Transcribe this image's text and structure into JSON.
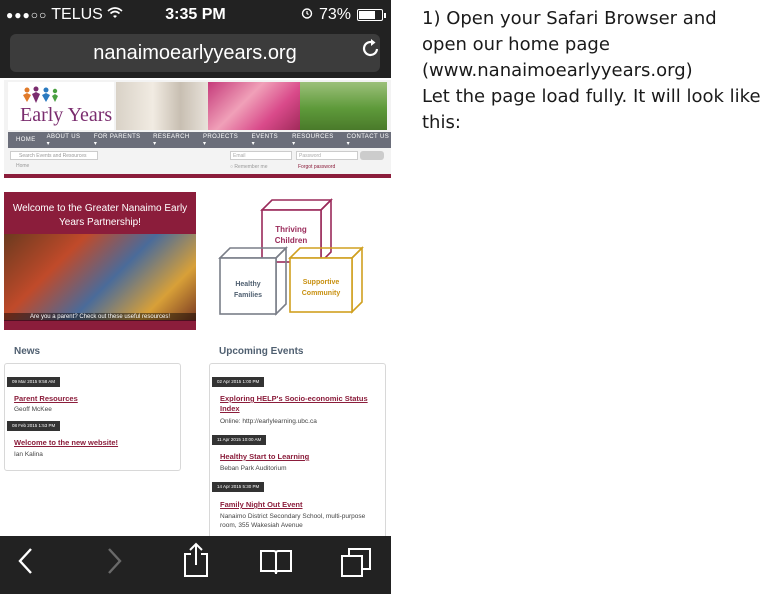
{
  "status_bar": {
    "carrier": "TELUS",
    "time": "3:35 PM",
    "battery": "73%"
  },
  "browser": {
    "url": "nanaimoearlyyears.org"
  },
  "site": {
    "logo_text": "Early Years",
    "nav": [
      "HOME",
      "ABOUT US ▾",
      "FOR PARENTS ▾",
      "RESEARCH ▾",
      "PROJECTS ▾",
      "EVENTS ▾",
      "RESOURCES ▾",
      "CONTACT US ▾"
    ],
    "search_placeholder": "Search Events and Resources",
    "breadcrumb": "Home",
    "email_placeholder": "Email",
    "password_placeholder": "Password",
    "remember": "Remember me",
    "forgot": "Forgot password"
  },
  "welcome": {
    "title": "Welcome to the Greater Nanaimo Early Years Partnership!",
    "caption": "Are you a parent? Check out these useful resources!"
  },
  "blocks": {
    "thriving_1": "Thriving",
    "thriving_2": "Children",
    "healthy_1": "Healthy",
    "healthy_2": "Families",
    "supportive_1": "Supportive",
    "supportive_2": "Community"
  },
  "news": {
    "title": "News",
    "items": [
      {
        "date": "09 Mar 2015 9:58 AM",
        "title": "Parent Resources",
        "author": "Geoff McKee"
      },
      {
        "date": "08 Feb 2015 1:53 PM",
        "title": "Welcome to the new website!",
        "author": "Ian Kalina"
      }
    ]
  },
  "events": {
    "title": "Upcoming Events",
    "items": [
      {
        "date": "02 Apr 2015 1:00 PM",
        "title": "Exploring HELP's Socio-economic Status Index",
        "location": "Online: http://earlylearning.ubc.ca"
      },
      {
        "date": "11 Apr 2015 10:00 AM",
        "title": "Healthy Start to Learning",
        "location": "Beban Park Auditorium"
      },
      {
        "date": "14 Apr 2015 5:30 PM",
        "title": "Family Night Out Event",
        "location": "Nanaimo District Secondary School, multi-purpose room, 355 Wakesiah Avenue"
      }
    ]
  },
  "instructions": [
    "1) Open your Safari Browser and",
    "open our home page",
    "(www.nanaimoearlyyears.org)",
    "Let the page load fully. It will look like",
    "this:"
  ],
  "colors": {
    "brand": "#8b1d3b",
    "chrome": "#222222",
    "nav": "#6b6e7a"
  },
  "icons": [
    "wifi-icon",
    "alarm-icon",
    "battery-icon",
    "reload-icon",
    "back-icon",
    "forward-icon",
    "share-icon",
    "bookmarks-icon",
    "tabs-icon"
  ]
}
